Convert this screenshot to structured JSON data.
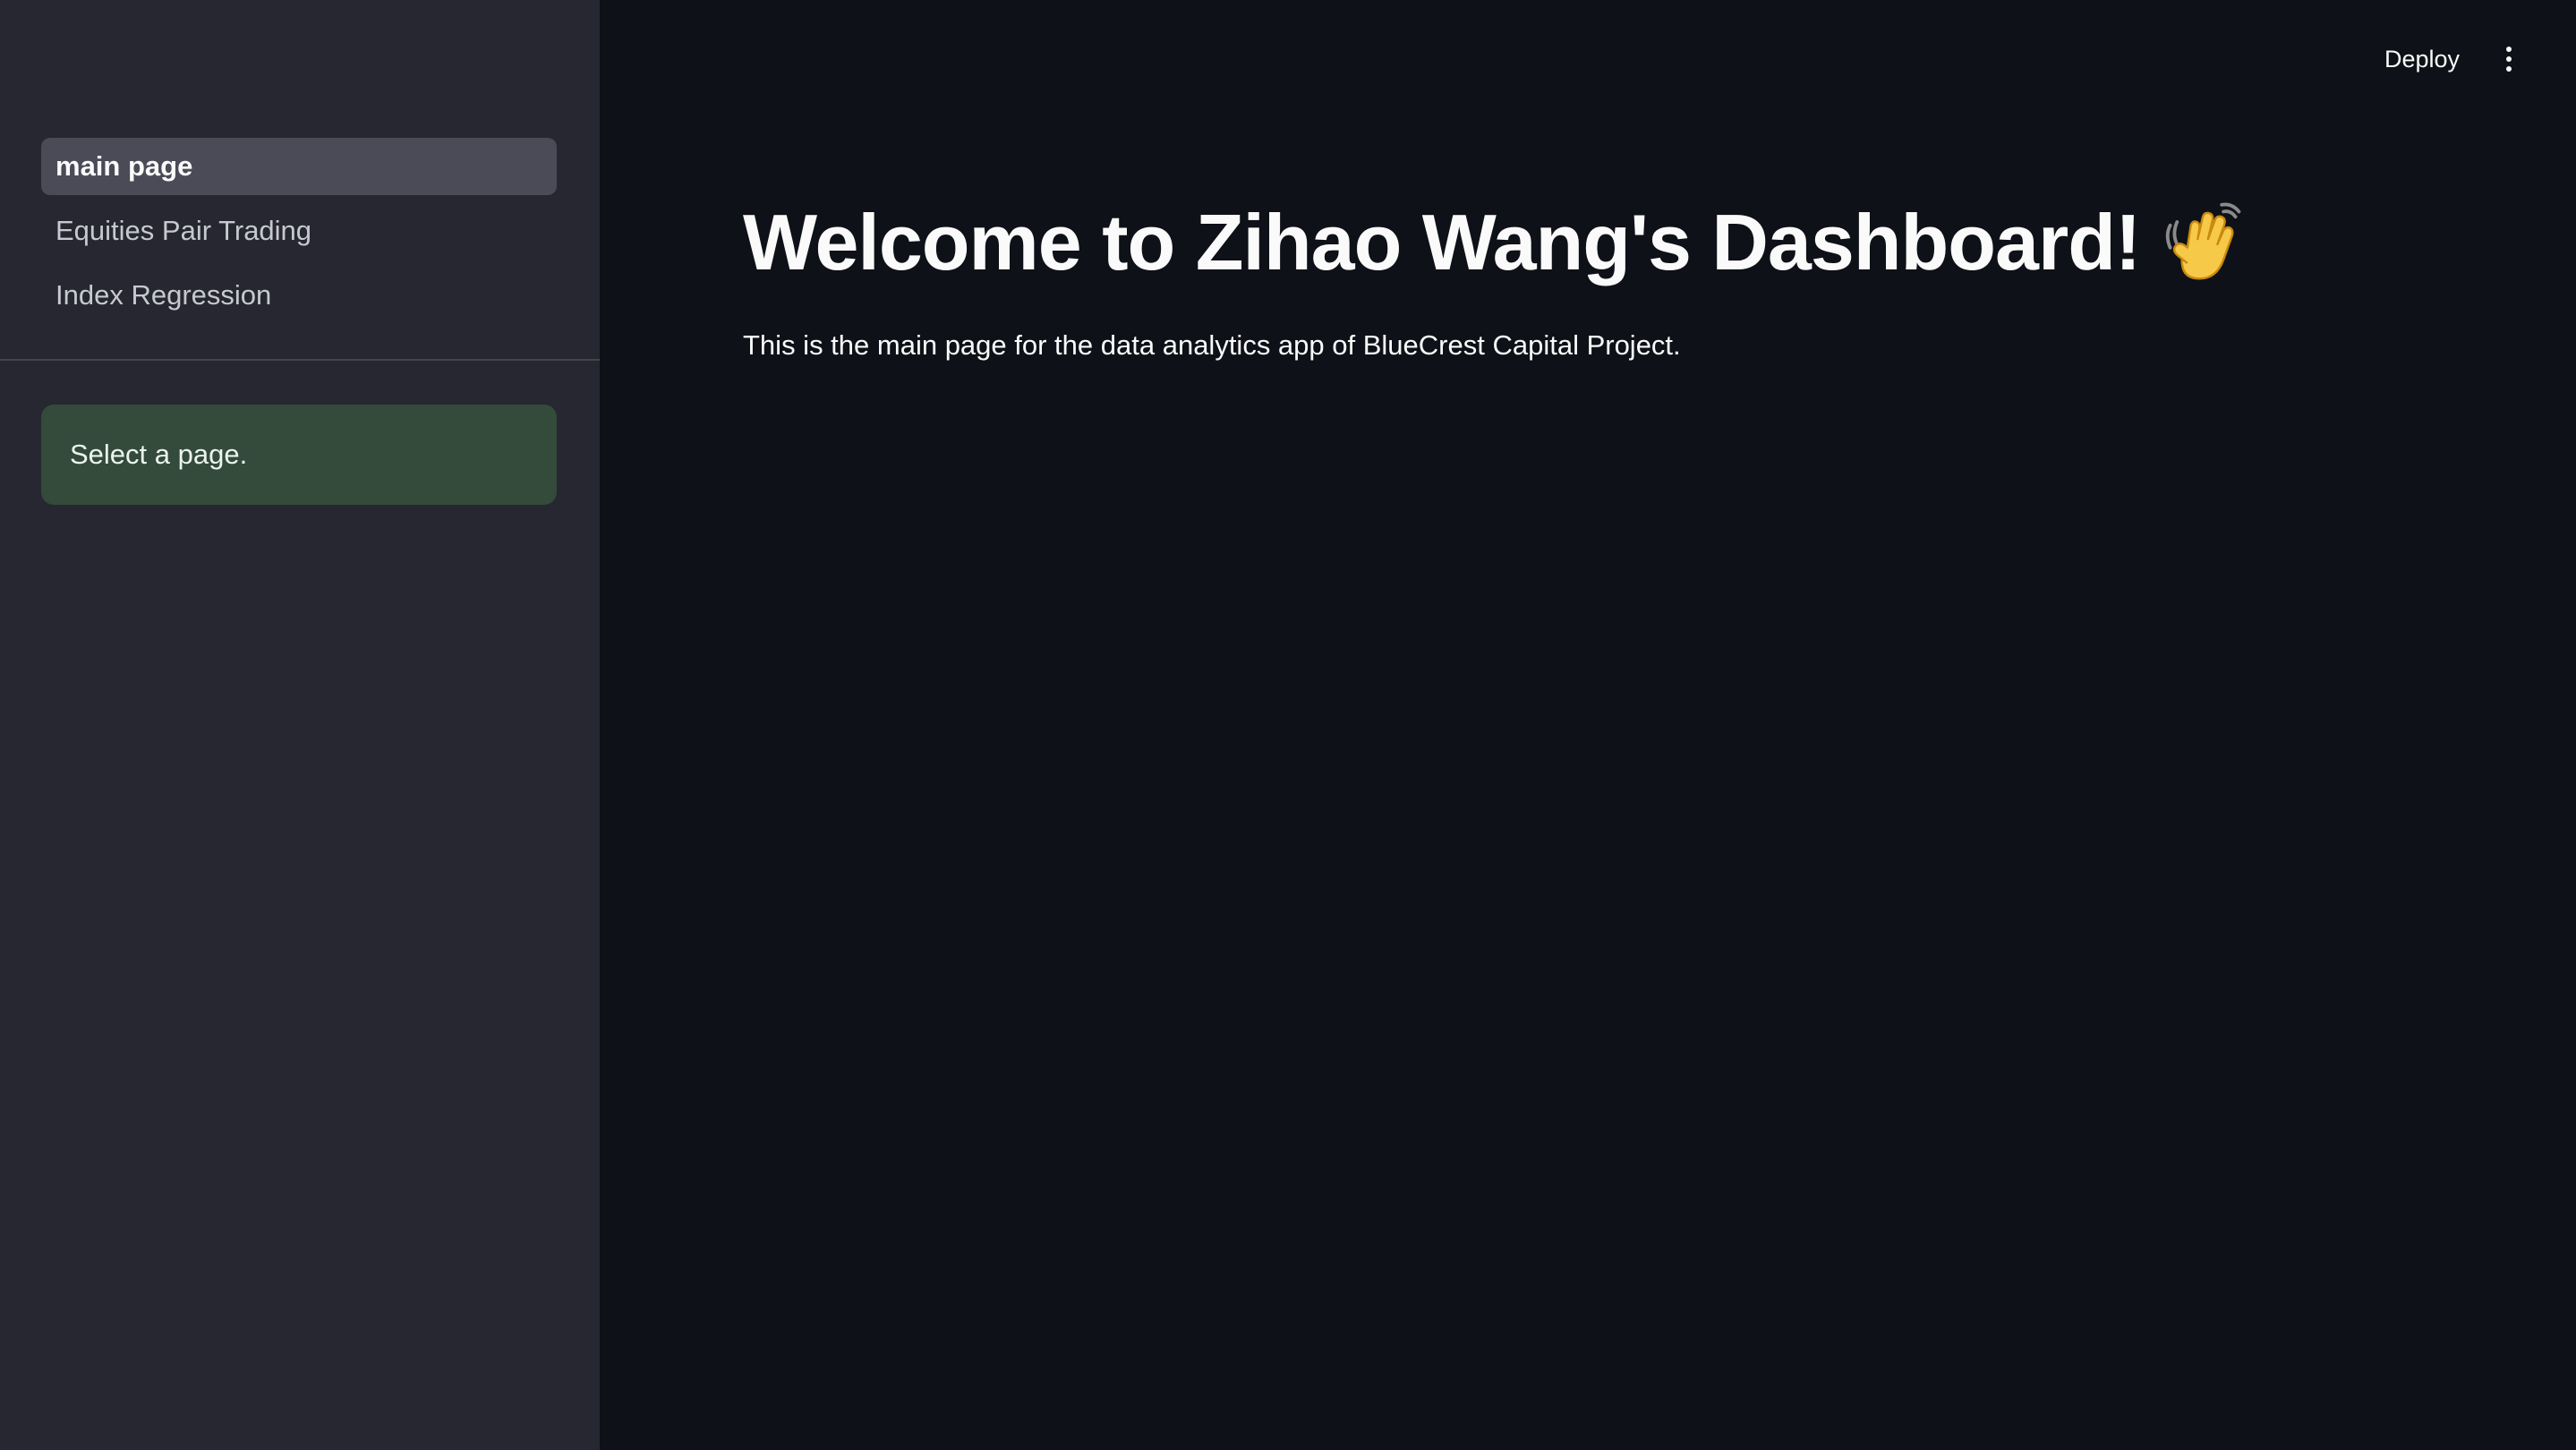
{
  "sidebar": {
    "nav_items": [
      {
        "label": "main page",
        "active": true
      },
      {
        "label": "Equities Pair Trading",
        "active": false
      },
      {
        "label": "Index Regression",
        "active": false
      }
    ],
    "info_message": "Select a page."
  },
  "toolbar": {
    "deploy_label": "Deploy",
    "menu_icon": "kebab-menu-icon"
  },
  "main": {
    "title": "Welcome to Zihao Wang's Dashboard!",
    "title_icon": "waving-hand-icon",
    "subtitle": "This is the main page for the data analytics app of BlueCrest Capital Project."
  },
  "colors": {
    "background": "#0e1117",
    "sidebar": "#262730",
    "active_nav": "#4a4b57",
    "info_box": "#344a3b",
    "text": "#fafafa"
  }
}
